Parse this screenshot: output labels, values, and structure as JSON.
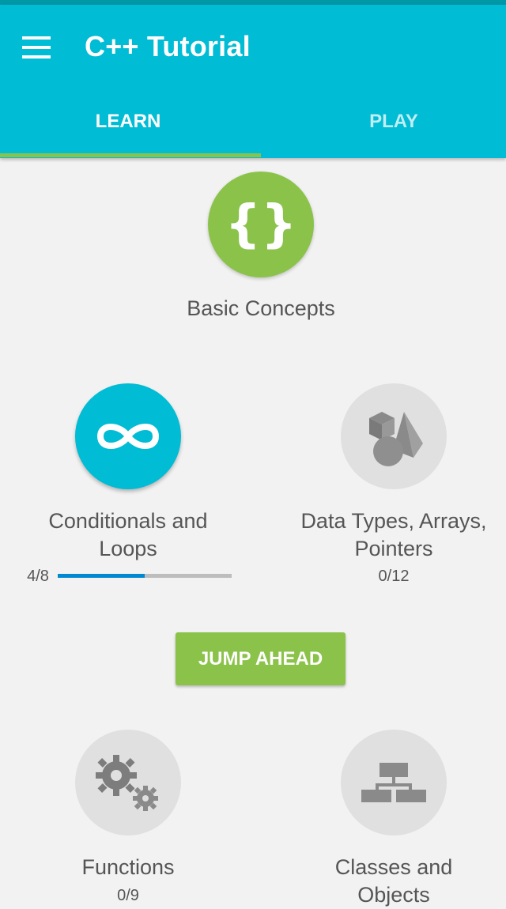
{
  "app": {
    "title": "C++ Tutorial",
    "menu_icon": "hamburger-menu-icon",
    "primary_color": "#00bcd4",
    "accent_color": "#8bc34a"
  },
  "tabs": [
    {
      "label": "LEARN",
      "selected": true
    },
    {
      "label": "PLAY",
      "selected": false
    }
  ],
  "modules": {
    "basic": {
      "label": "Basic Concepts",
      "icon": "curly-braces-icon",
      "state": "completed"
    },
    "conditionals": {
      "line1": "Conditionals and",
      "line2": "Loops",
      "icon": "infinity-icon",
      "state": "in-progress",
      "count": "4/8",
      "progress": 0.5
    },
    "datatypes": {
      "line1": "Data Types, Arrays,",
      "line2": "Pointers",
      "icon": "shapes-icon",
      "state": "locked",
      "count": "0/12"
    },
    "functions": {
      "line1": "Functions",
      "icon": "gears-icon",
      "state": "locked",
      "count": "0/9"
    },
    "classes": {
      "line1": "Classes and",
      "line2": "Objects",
      "icon": "hierarchy-icon",
      "state": "locked"
    }
  },
  "jump_button": {
    "label": "JUMP AHEAD"
  }
}
